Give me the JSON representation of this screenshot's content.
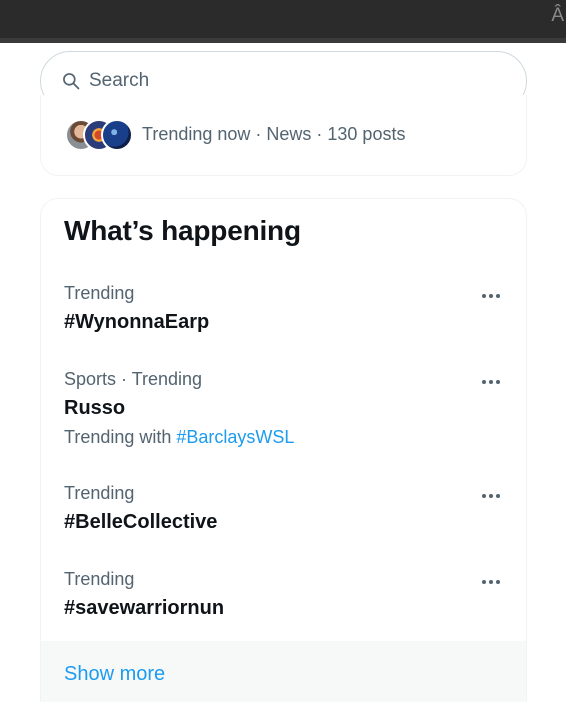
{
  "topbar": {
    "corner_glyph": "Â"
  },
  "search": {
    "placeholder": "Search",
    "value": "",
    "icon": "search-icon"
  },
  "trend_card": {
    "text": "Trending now · News · 130 posts",
    "avatars": [
      "avatar-person",
      "avatar-graphic",
      "avatar-planet"
    ]
  },
  "happening": {
    "title": "What’s happening",
    "items": [
      {
        "meta": "Trending",
        "title": "#WynonnaEarp"
      },
      {
        "meta": "Sports · Trending",
        "title": "Russo",
        "with_label": "Trending with",
        "with_tag": "#BarclaysWSL"
      },
      {
        "meta": "Trending",
        "title": "#BelleCollective"
      },
      {
        "meta": "Trending",
        "title": "#savewarriornun"
      }
    ],
    "show_more": "Show more"
  },
  "colors": {
    "accent": "#1d9bf0",
    "text_primary": "#0f1419",
    "text_secondary": "#536471",
    "border": "#eff3f4",
    "topbar": "#2b2b2b"
  }
}
